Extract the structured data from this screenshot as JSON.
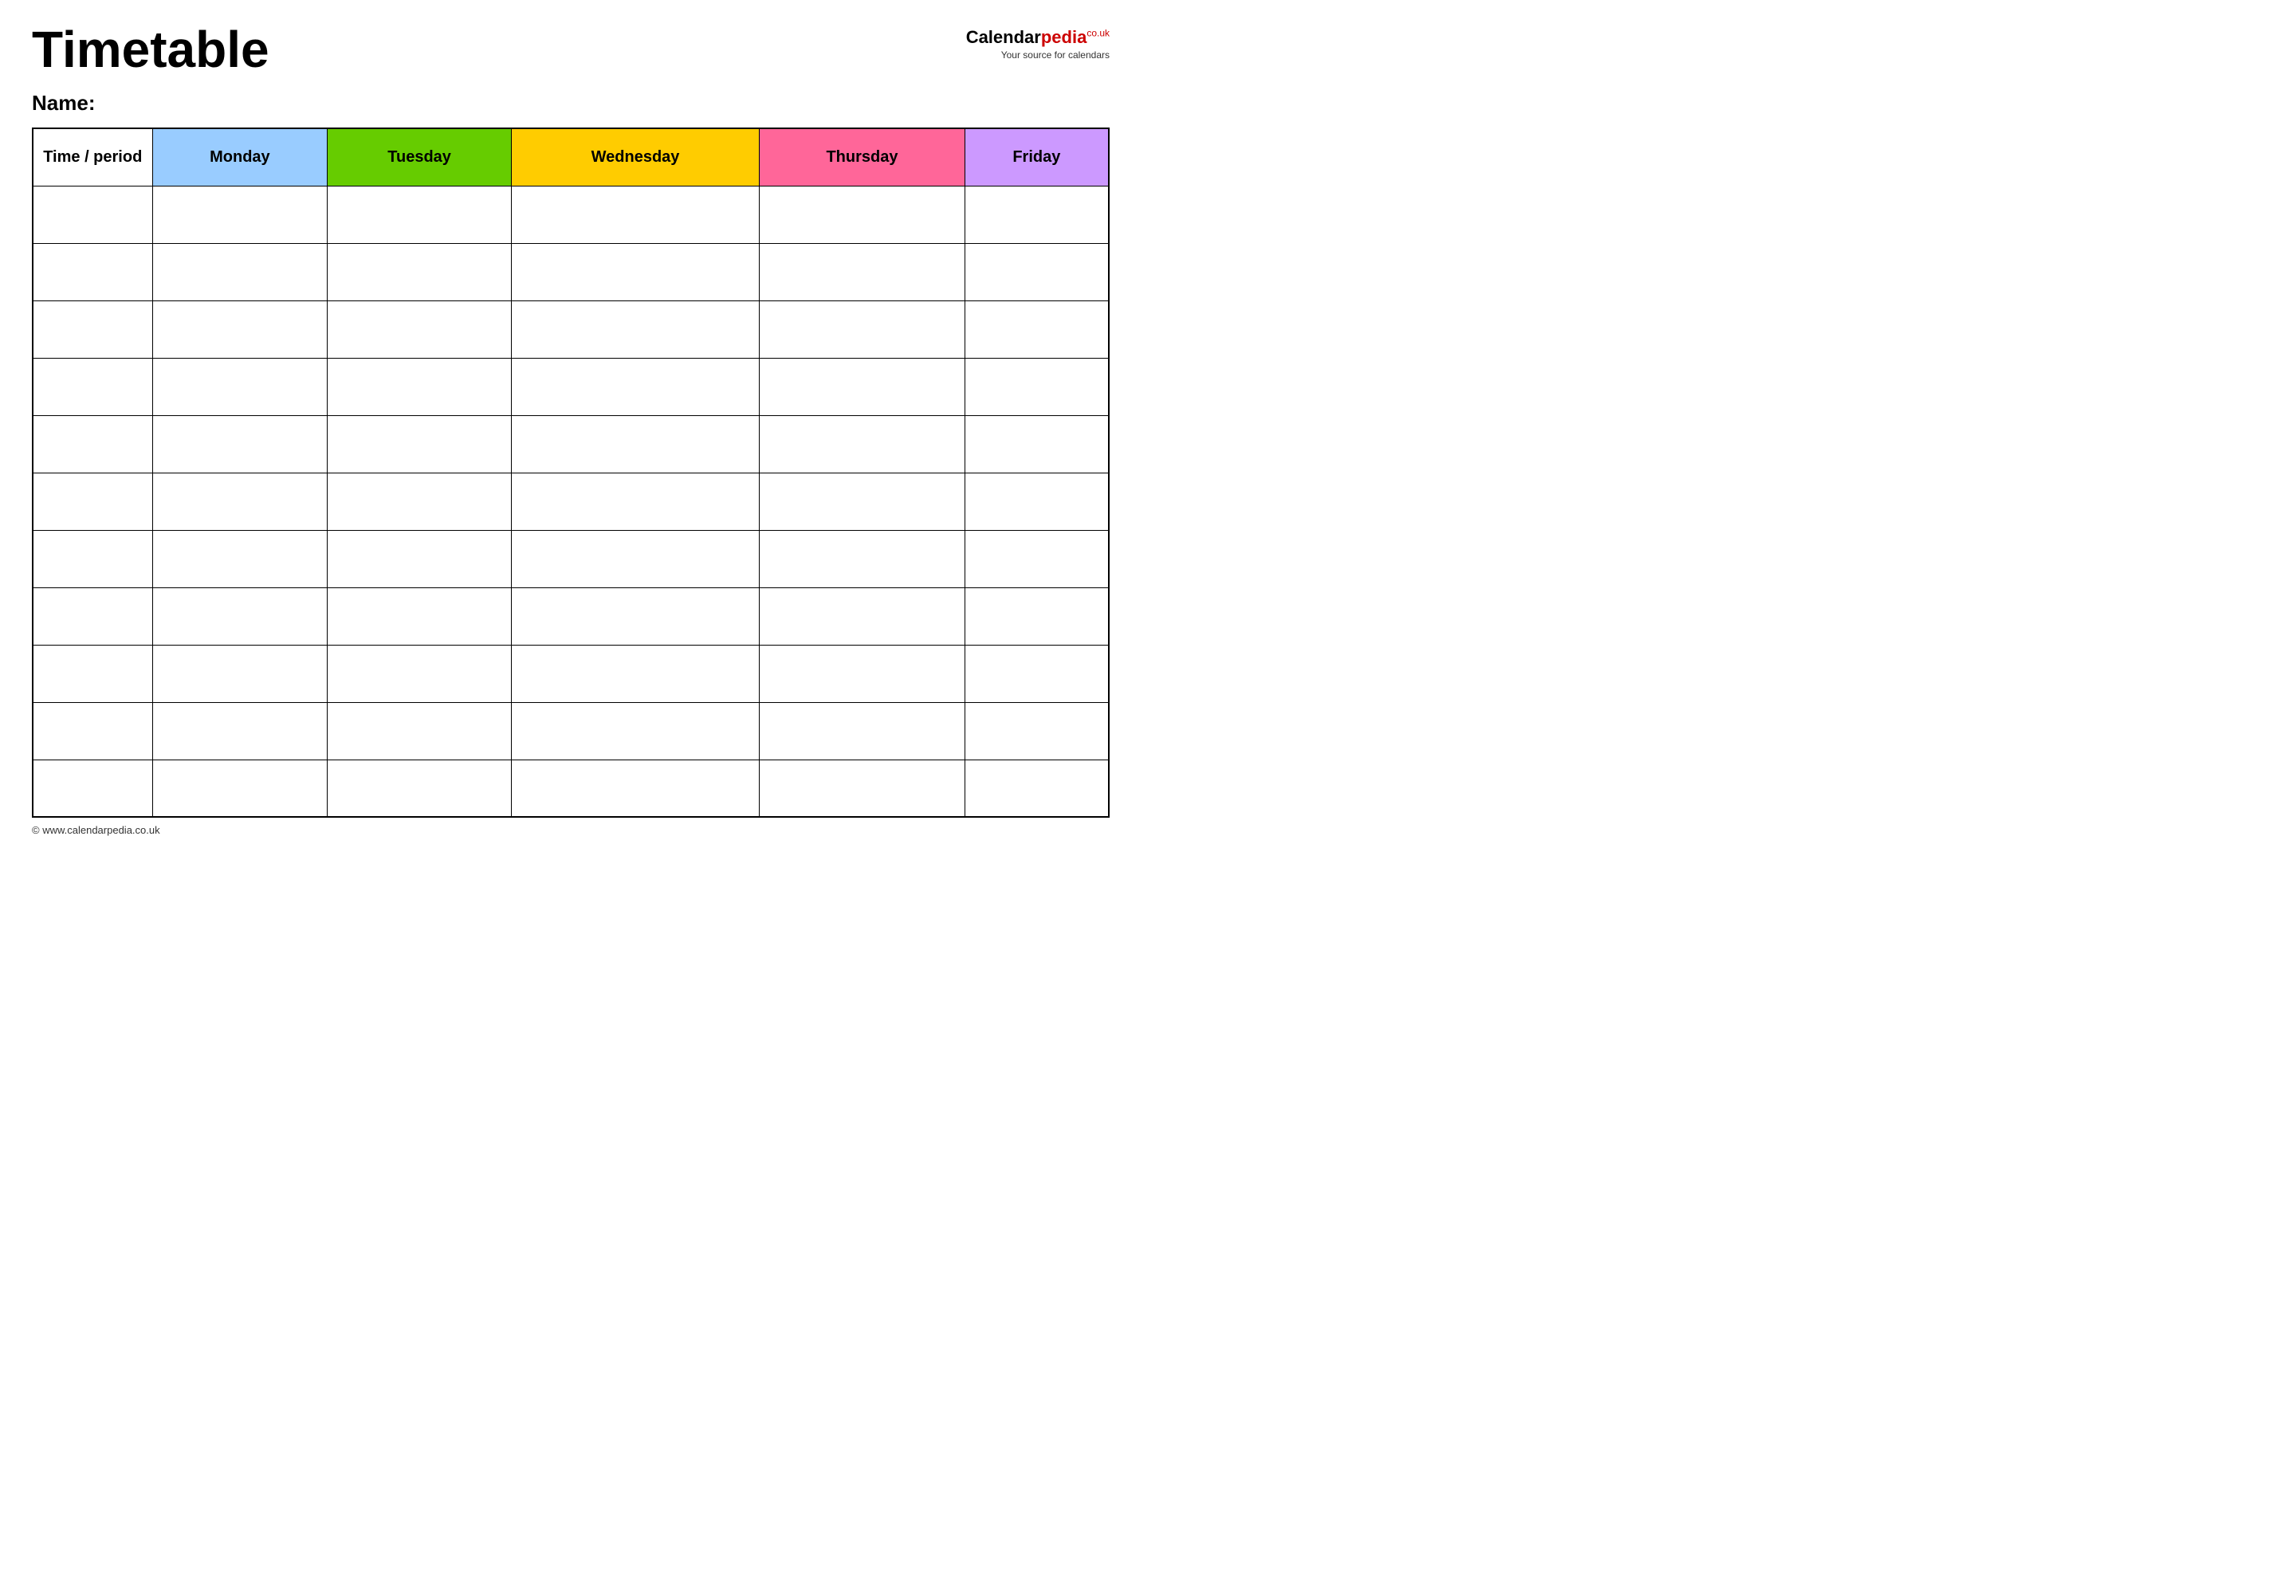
{
  "header": {
    "title": "Timetable",
    "logo": {
      "calendar_text": "Calendar",
      "pedia_text": "pedia",
      "couk_text": "co.uk",
      "tagline": "Your source for calendars"
    }
  },
  "name_section": {
    "label": "Name:"
  },
  "table": {
    "headers": {
      "time_period": "Time / period",
      "monday": "Monday",
      "tuesday": "Tuesday",
      "wednesday": "Wednesday",
      "thursday": "Thursday",
      "friday": "Friday"
    },
    "row_count": 11
  },
  "footer": {
    "url": "© www.calendarpedia.co.uk"
  }
}
